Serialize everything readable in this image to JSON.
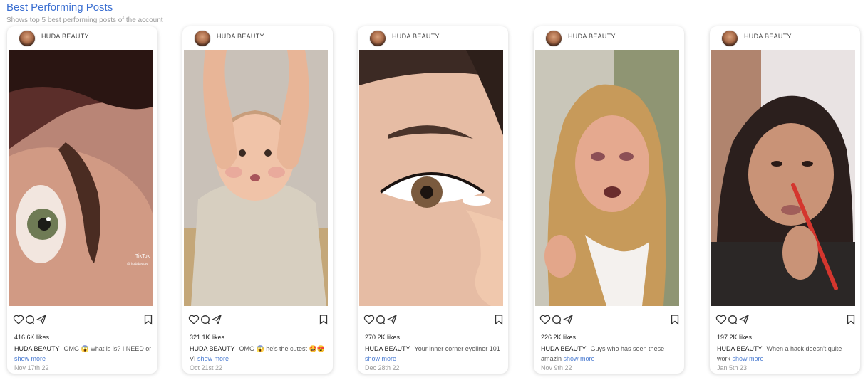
{
  "section": {
    "title": "Best Performing Posts",
    "subtitle": "Shows top 5 best performing posts of the account"
  },
  "icons": {
    "like": "heart-icon",
    "comment": "comment-icon",
    "share": "send-icon",
    "save": "bookmark-icon"
  },
  "posts": [
    {
      "account": "HUDA BEAUTY",
      "likes": "416.6K likes",
      "handle": "HUDA BEAUTY",
      "caption": "OMG 😱 what is is? I NEED one!",
      "caption_cont": "",
      "show_more": "show more",
      "date": "Nov 17th 22",
      "overlay": "TikTok",
      "overlay_sub": "@ hudabeauty"
    },
    {
      "account": "HUDA BEAUTY",
      "likes": "321.1K likes",
      "handle": "HUDA BEAUTY",
      "caption": "OMG 😱 he's the cutest 🤩😍",
      "caption_cont": "VI",
      "show_more": "show more",
      "date": "Oct 21st 22"
    },
    {
      "account": "HUDA BEAUTY",
      "likes": "270.2K likes",
      "handle": "HUDA BEAUTY",
      "caption": "Your inner corner eyeliner 101",
      "caption_cont": "",
      "show_more": "show more",
      "date": "Dec 28th 22"
    },
    {
      "account": "HUDA BEAUTY",
      "likes": "226.2K likes",
      "handle": "HUDA BEAUTY",
      "caption": "Guys who has seen these",
      "caption_cont": "amazin",
      "show_more": "show more",
      "date": "Nov 9th 22"
    },
    {
      "account": "HUDA BEAUTY",
      "likes": "197.2K likes",
      "handle": "HUDA BEAUTY",
      "caption": "When a hack doesn't quite",
      "caption_cont": "work",
      "show_more": "show more",
      "date": "Jan 5th 23"
    }
  ]
}
